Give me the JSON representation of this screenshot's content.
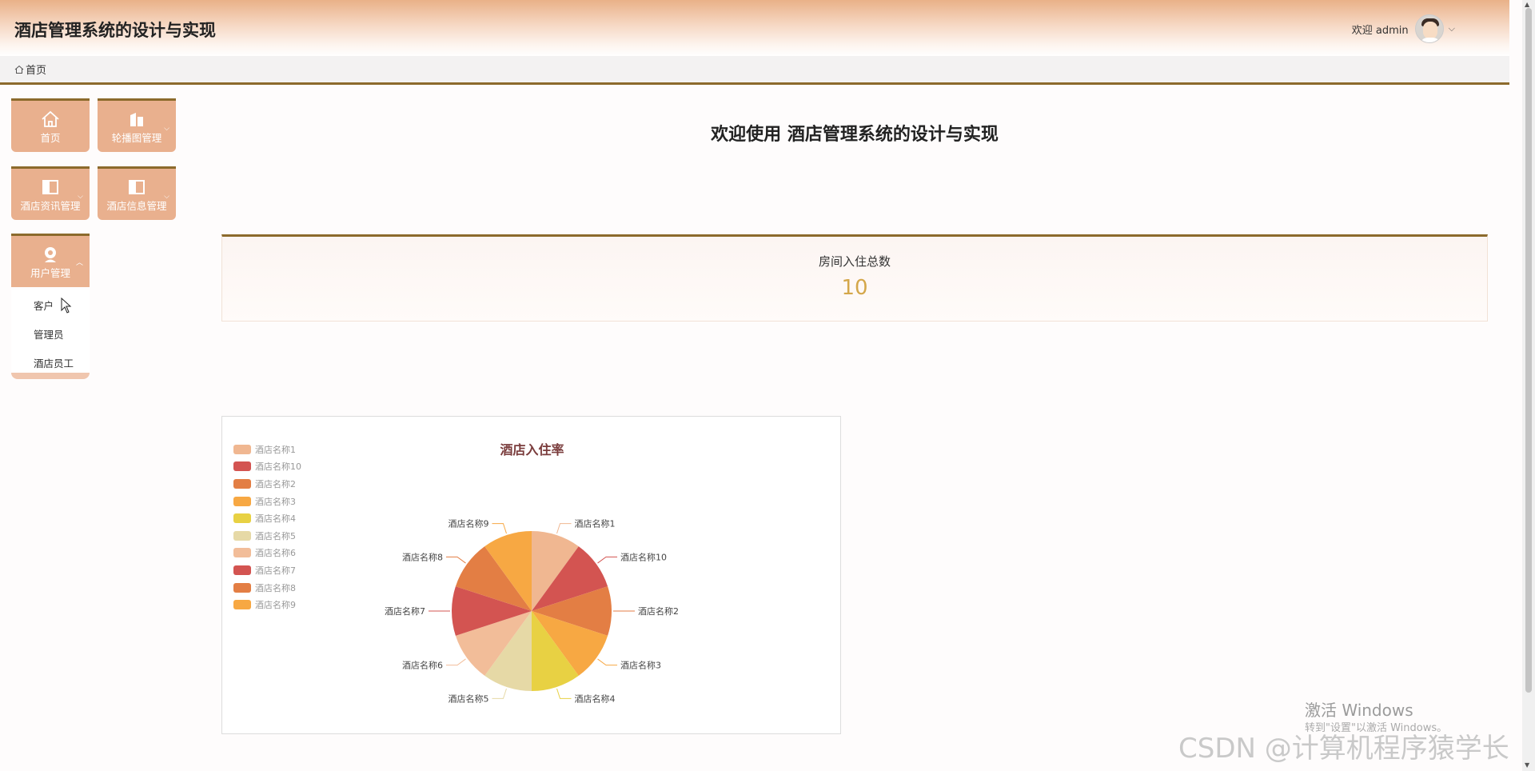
{
  "header": {
    "app_title": "酒店管理系统的设计与实现",
    "welcome_user": "欢迎 admin",
    "avatar_icon": "user-avatar-icon",
    "menu_chevron": "⌵"
  },
  "breadcrumb": {
    "home_label": "首页"
  },
  "sidebar": {
    "tiles": [
      {
        "label": "首页",
        "icon": "home-icon"
      },
      {
        "label": "轮播图管理",
        "icon": "building-icon"
      },
      {
        "label": "酒店资讯管理",
        "icon": "panel-icon"
      },
      {
        "label": "酒店信息管理",
        "icon": "panel-icon"
      },
      {
        "label": "用户管理",
        "icon": "user-icon"
      }
    ],
    "user_submenu": [
      "客户",
      "管理员",
      "酒店员工"
    ]
  },
  "main": {
    "welcome": "欢迎使用 酒店管理系统的设计与实现",
    "stat": {
      "label": "房间入住总数",
      "value": "10"
    }
  },
  "chart_data": {
    "type": "pie",
    "title": "酒店入住率",
    "categories": [
      "酒店名称1",
      "酒店名称10",
      "酒店名称2",
      "酒店名称3",
      "酒店名称4",
      "酒店名称5",
      "酒店名称6",
      "酒店名称7",
      "酒店名称8",
      "酒店名称9"
    ],
    "values": [
      1,
      1,
      1,
      1,
      1,
      1,
      1,
      1,
      1,
      1
    ],
    "colors": [
      "#f0b791",
      "#d35451",
      "#e37e44",
      "#f7a843",
      "#e8d143",
      "#e6d9a6",
      "#f2bd99",
      "#d35451",
      "#e37e44",
      "#f7a843"
    ],
    "legend_position": "top-left"
  },
  "overlay": {
    "activate_title": "激活 Windows",
    "activate_sub": "转到\"设置\"以激活 Windows。",
    "csdn_mark": "CSDN @计算机程序猿学长"
  }
}
